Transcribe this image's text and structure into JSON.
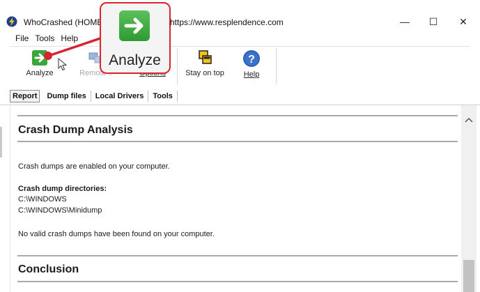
{
  "window": {
    "app_name": "WhoCrashed",
    "title_text": "WhoCrashed  (HOME",
    "title_url": "https://www.resplendence.com",
    "minimize_symbol": "—",
    "maximize_symbol": "☐",
    "close_symbol": "✕"
  },
  "menu": {
    "items": [
      {
        "label": "File"
      },
      {
        "label": "Tools"
      },
      {
        "label": "Help"
      }
    ]
  },
  "toolbar": {
    "analyze_label": "Analyze",
    "remote_label": "Remote ..",
    "options_label": "Options",
    "stayontop_label": "Stay on top",
    "help_label": "Help"
  },
  "tabs": [
    {
      "label": "Report",
      "active": true
    },
    {
      "label": "Dump files",
      "active": false
    },
    {
      "label": "Local Drivers",
      "active": false
    },
    {
      "label": "Tools",
      "active": false
    }
  ],
  "report": {
    "heading1": "Crash Dump Analysis",
    "line1": "Crash dumps are enabled on your computer.",
    "dir_heading": "Crash dump directories:",
    "dir1": "C:\\WINDOWS",
    "dir2": "C:\\WINDOWS\\Minidump",
    "line2": "No valid crash dumps have been found on your computer.",
    "heading2": "Conclusion"
  },
  "callout": {
    "label": "Analyze"
  },
  "colors": {
    "callout_border": "#d7232e",
    "analyze_icon_green": "#3aa63a",
    "help_icon_blue": "#2f5fb3"
  },
  "icons": {
    "app": "whocrashed-icon",
    "analyze": "green-arrow-icon",
    "remote": "remote-computers-icon",
    "options": "options-icon",
    "stayontop": "stacked-windows-icon",
    "help": "question-mark-icon"
  }
}
